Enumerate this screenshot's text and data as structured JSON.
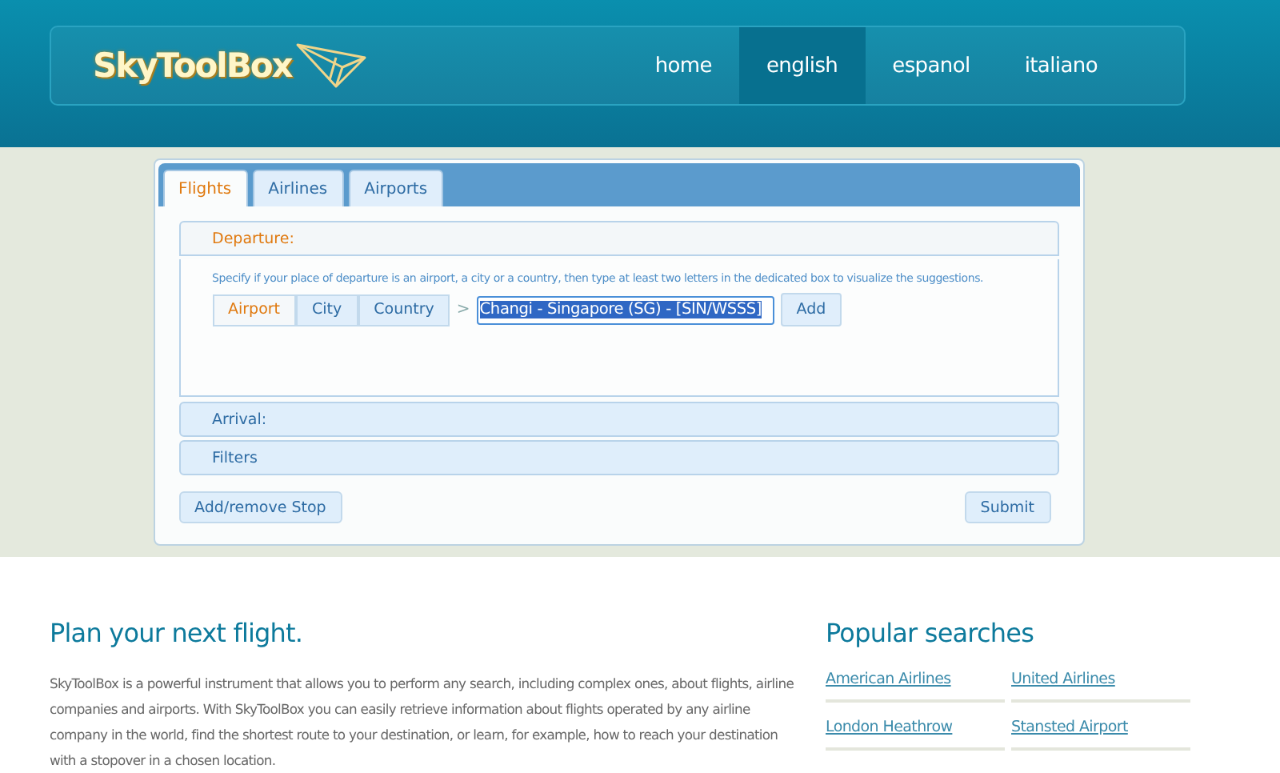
{
  "header": {
    "logo": "SkyToolBox",
    "nav": [
      {
        "label": "home",
        "selected": false
      },
      {
        "label": "english",
        "selected": true
      },
      {
        "label": "espanol",
        "selected": false
      },
      {
        "label": "italiano",
        "selected": false
      }
    ]
  },
  "search_panel": {
    "tabs": [
      {
        "label": "Flights",
        "selected": true
      },
      {
        "label": "Airlines",
        "selected": false
      },
      {
        "label": "Airports",
        "selected": false
      }
    ],
    "sections": [
      {
        "title": "Departure:",
        "expanded": true,
        "hint": "Specify if your place of departure is an airport, a city or a country, then type at least two letters in the dedicated box to visualize the suggestions.",
        "types": [
          {
            "label": "Airport",
            "selected": true
          },
          {
            "label": "City",
            "selected": false
          },
          {
            "label": "Country",
            "selected": false
          }
        ],
        "separator": ">",
        "value": "Changi - Singapore (SG) - [SIN/WSSS]",
        "add_button": "Add"
      },
      {
        "title": "Arrival:",
        "expanded": false
      },
      {
        "title": "Filters",
        "expanded": false
      }
    ],
    "buttons": [
      "Add/remove Stop",
      "Submit"
    ]
  },
  "intro": {
    "title": "Plan your next flight.",
    "text": "SkyToolBox is a powerful instrument that allows you to perform any search, including complex ones, about flights, airline companies and airports. With SkyToolBox you can easily retrieve information about flights operated by any airline company in the world, find the shortest route to your destination, or learn, for example, how to reach your destination with a stopover in a chosen location."
  },
  "popular": {
    "title": "Popular searches",
    "links": [
      "American Airlines",
      "United Airlines",
      "London Heathrow",
      "Stansted Airport"
    ]
  }
}
